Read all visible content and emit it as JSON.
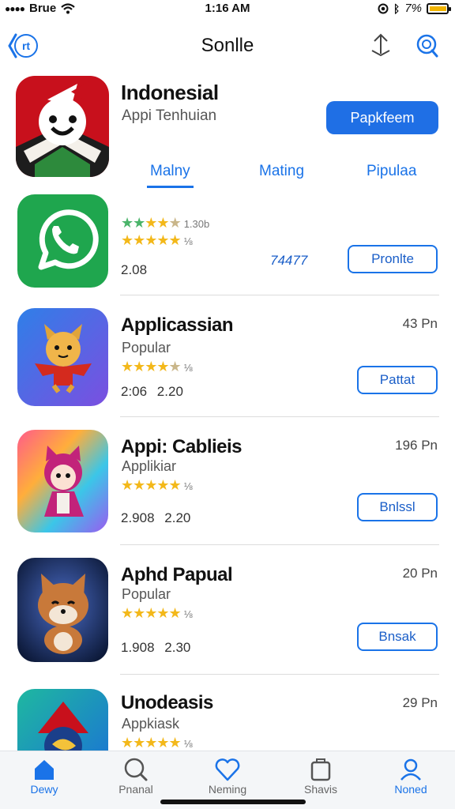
{
  "status_bar": {
    "carrier": "Brue",
    "time": "1:16 AM",
    "battery": "7%",
    "battery_level": 0.9
  },
  "nav": {
    "title": "Sonlle",
    "back_icon": "back-icon",
    "share_icon": "share-icon",
    "search_icon": "search-icon"
  },
  "featured": {
    "title": "Indonesial",
    "subtitle": "Appi Tenhuian",
    "button": "Papkfeem",
    "tabs": [
      "Malny",
      "Mating",
      "Pipulaa"
    ],
    "active_tab": 0
  },
  "apps": [
    {
      "rating_line": "1.30b",
      "meta": "74477",
      "numbers": "2.08",
      "button": "Pronlte"
    },
    {
      "name": "Applicassian",
      "category": "Popular",
      "numbers": "2:06 2.20",
      "size": "43 Pn",
      "button": "Pattat"
    },
    {
      "name": "Appi: Cablieis",
      "category": "Applikiar",
      "numbers": "2.908 2.20",
      "size": "196 Pn",
      "button": "Bnlssl"
    },
    {
      "name": "Aphd Papual",
      "category": "Popular",
      "numbers": "1.908 2.30",
      "size": "20 Pn",
      "button": "Bnsak"
    },
    {
      "name": "Unodeasis",
      "category": "Appkiask",
      "size": "29 Pn"
    }
  ],
  "tab_bar": [
    {
      "label": "Dewy",
      "icon": "home-icon"
    },
    {
      "label": "Pnanal",
      "icon": "search-icon"
    },
    {
      "label": "Neming",
      "icon": "heart-icon"
    },
    {
      "label": "Shavis",
      "icon": "bag-icon"
    },
    {
      "label": "Noned",
      "icon": "profile-icon"
    }
  ],
  "colors": {
    "accent": "#1a73e8",
    "star": "#f3b81a",
    "button_fill": "#1f6fe5"
  }
}
